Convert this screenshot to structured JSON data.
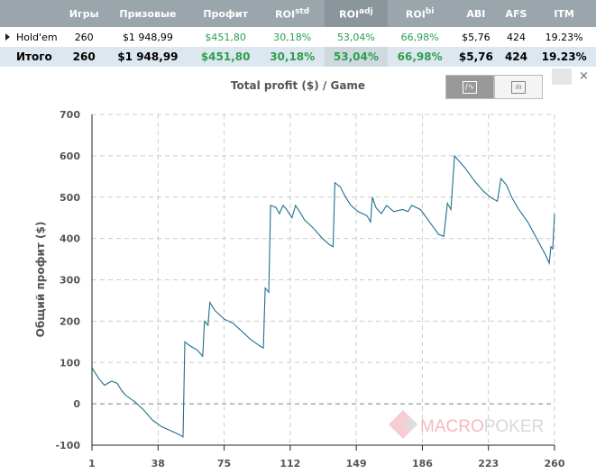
{
  "table": {
    "headers": [
      "",
      "Игры",
      "Призовые",
      "Профит",
      "ROI",
      "ROI",
      "ROI",
      "ABI",
      "AFS",
      "ITM"
    ],
    "roi_sups": [
      "std",
      "adj",
      "bi"
    ],
    "rows": [
      {
        "name": "Hold'em",
        "games": "260",
        "prize": "$1 948,99",
        "profit": "$451,80",
        "roi_std": "30,18%",
        "roi_adj": "53,04%",
        "roi_bi": "66,98%",
        "abi": "$5,76",
        "afs": "424",
        "itm": "19.23%"
      },
      {
        "name": "Итого",
        "games": "260",
        "prize": "$1 948,99",
        "profit": "$451,80",
        "roi_std": "30,18%",
        "roi_adj": "53,04%",
        "roi_bi": "66,98%",
        "abi": "$5,76",
        "afs": "424",
        "itm": "19.23%"
      }
    ]
  },
  "controls": {
    "line_icon": "line-chart-icon",
    "bar_icon": "bar-chart-icon",
    "camera_icon": "camera-icon",
    "close": "×"
  },
  "watermark": "MACROPOKER",
  "colors": {
    "line": "#1f6f8f",
    "profit_green": "#2e9e4e",
    "header": "#9aa5ac"
  },
  "chart_data": {
    "type": "line",
    "title": "Total profit ($) / Game",
    "xlabel": "",
    "ylabel": "Общий профит ($)",
    "xlim": [
      1,
      260
    ],
    "ylim": [
      -100,
      700
    ],
    "xticks": [
      1,
      38,
      75,
      112,
      149,
      186,
      223,
      260
    ],
    "yticks": [
      -100,
      0,
      100,
      200,
      300,
      400,
      500,
      600,
      700
    ],
    "grid": true,
    "x": [
      1,
      5,
      8,
      12,
      15,
      18,
      20,
      25,
      30,
      35,
      40,
      45,
      50,
      52,
      53,
      56,
      60,
      63,
      64,
      66,
      67,
      70,
      75,
      80,
      85,
      90,
      95,
      97,
      98,
      100,
      101,
      104,
      106,
      108,
      110,
      113,
      115,
      118,
      120,
      125,
      130,
      134,
      136,
      137,
      140,
      143,
      146,
      150,
      155,
      157,
      158,
      160,
      163,
      166,
      170,
      175,
      178,
      180,
      185,
      190,
      195,
      198,
      200,
      202,
      204,
      206,
      210,
      215,
      220,
      224,
      228,
      230,
      233,
      236,
      240,
      245,
      250,
      255,
      257,
      258,
      259,
      260
    ],
    "y": [
      87,
      60,
      45,
      55,
      50,
      30,
      20,
      5,
      -15,
      -40,
      -55,
      -65,
      -75,
      -80,
      150,
      140,
      130,
      115,
      200,
      190,
      245,
      225,
      205,
      195,
      175,
      155,
      140,
      135,
      280,
      270,
      480,
      475,
      460,
      480,
      470,
      450,
      480,
      460,
      445,
      425,
      400,
      385,
      380,
      535,
      525,
      500,
      480,
      465,
      455,
      440,
      500,
      475,
      460,
      480,
      465,
      470,
      465,
      480,
      470,
      440,
      410,
      405,
      485,
      470,
      600,
      590,
      570,
      540,
      515,
      500,
      490,
      545,
      530,
      500,
      470,
      440,
      400,
      360,
      340,
      380,
      375,
      460
    ]
  }
}
